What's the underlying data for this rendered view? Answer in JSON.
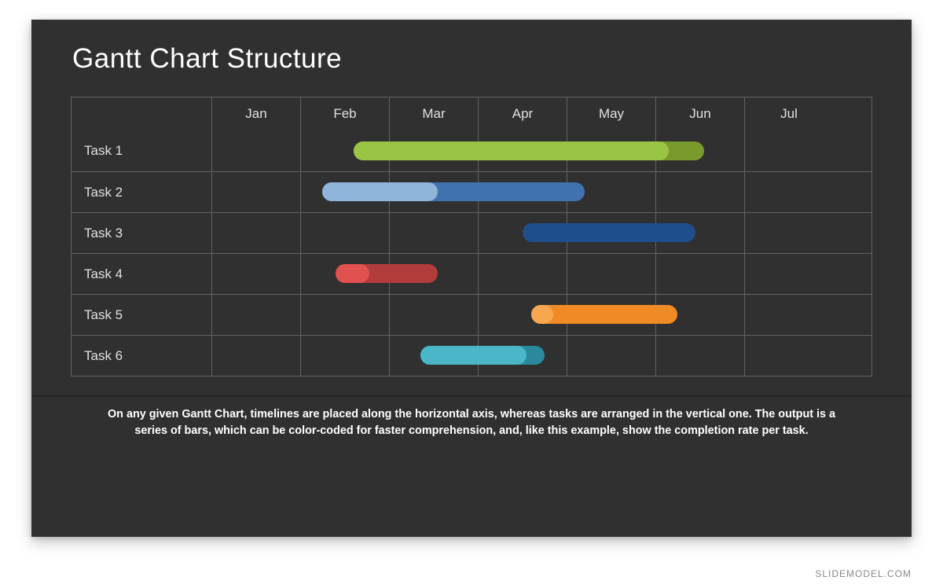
{
  "watermark": "SLIDEMODEL.COM",
  "title": "Gantt Chart Structure",
  "caption": "On any given Gantt Chart, timelines are placed along the horizontal axis, whereas tasks are arranged in the vertical one. The output is a series of bars, which can be color-coded for faster comprehension, and, like this example, show the completion rate per task.",
  "chart_data": {
    "type": "bar",
    "orientation": "horizontal-gantt",
    "categories": [
      "Jan",
      "Feb",
      "Mar",
      "Apr",
      "May",
      "Jun",
      "Jul"
    ],
    "x_unit": "month",
    "xlim": [
      0,
      7
    ],
    "series": [
      {
        "name": "Task 1",
        "start": 1.6,
        "end": 5.55,
        "complete_end": 5.15,
        "color_bar": "#7a9a2e",
        "color_done": "#9ac544"
      },
      {
        "name": "Task 2",
        "start": 1.25,
        "end": 4.2,
        "complete_end": 2.55,
        "color_bar": "#3f72af",
        "color_done": "#8fb5da"
      },
      {
        "name": "Task 3",
        "start": 3.5,
        "end": 5.45,
        "complete_end": 5.15,
        "color_bar": "#1f4e8c",
        "color_done": "#1f4e8c"
      },
      {
        "name": "Task 4",
        "start": 1.4,
        "end": 2.55,
        "complete_end": 1.78,
        "color_bar": "#b13c3b",
        "color_done": "#e0514f"
      },
      {
        "name": "Task 5",
        "start": 3.6,
        "end": 5.25,
        "complete_end": 3.85,
        "color_bar": "#f08a24",
        "color_done": "#f7a74f"
      },
      {
        "name": "Task 6",
        "start": 2.35,
        "end": 3.75,
        "complete_end": 3.55,
        "color_bar": "#2a8a9d",
        "color_done": "#4cb6c9"
      }
    ]
  }
}
